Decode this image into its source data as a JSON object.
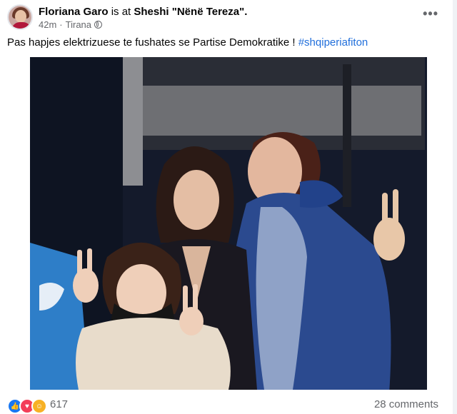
{
  "post": {
    "author": "Floriana Garo",
    "connector": " is at ",
    "location": "Sheshi \"Nënë Tereza\".",
    "time": "42m",
    "separator": "·",
    "place": "Tirana",
    "more_label": "•••",
    "caption": "Pas hapjes elektrizuese te fushates se Partise Demokratike ! ",
    "hashtag": "#shqiperiafiton"
  },
  "footer": {
    "reactions": [
      "like-icon",
      "love-icon",
      "care-icon"
    ],
    "reaction_count": "617",
    "comments": "28 comments"
  },
  "colors": {
    "hashtag": "#216fdb",
    "muted": "#65676b",
    "photo_bg": "#0d1324"
  }
}
